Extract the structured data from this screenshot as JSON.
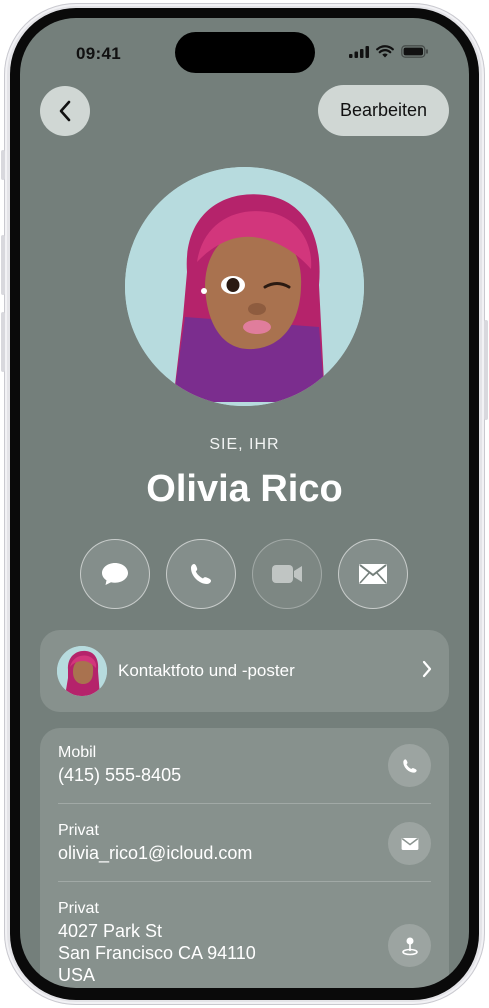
{
  "status_bar": {
    "time": "09:41"
  },
  "nav": {
    "edit_label": "Bearbeiten"
  },
  "contact": {
    "pronouns": "SIE, IHR",
    "name": "Olivia Rico"
  },
  "poster": {
    "label": "Kontaktfoto und -poster"
  },
  "fields": [
    {
      "label": "Mobil",
      "value": "(415) 555-8405"
    },
    {
      "label": "Privat",
      "value": "olivia_rico1@icloud.com"
    },
    {
      "label": "Privat",
      "lines": [
        "4027 Park St",
        "San Francisco CA 94110",
        "USA"
      ]
    }
  ],
  "colors": {
    "background": "#747f7b",
    "avatar_bg": "#b7dbde",
    "hair": "#c2306e"
  },
  "icons": [
    "back-chevron-icon",
    "message-icon",
    "phone-icon",
    "video-icon",
    "mail-icon",
    "map-pin-icon"
  ]
}
